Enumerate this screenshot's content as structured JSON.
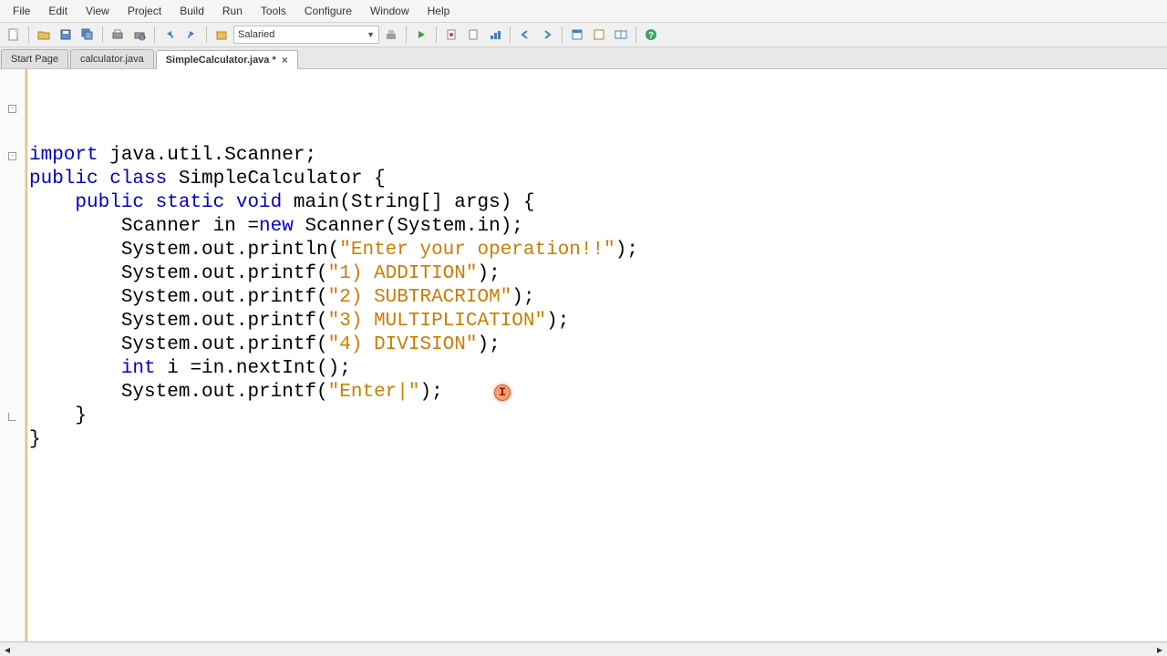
{
  "menu": {
    "items": [
      "File",
      "Edit",
      "View",
      "Project",
      "Build",
      "Run",
      "Tools",
      "Configure",
      "Window",
      "Help"
    ]
  },
  "toolbar": {
    "dropdown_value": "Salaried"
  },
  "tabs": [
    {
      "label": "Start Page",
      "active": false,
      "closable": false
    },
    {
      "label": "calculator.java",
      "active": false,
      "closable": false
    },
    {
      "label": "SimpleCalculator.java *",
      "active": true,
      "closable": true
    }
  ],
  "code": {
    "lines": [
      {
        "tokens": [
          {
            "t": "import ",
            "c": "kw"
          },
          {
            "t": "java.util.Scanner;",
            "c": "norm"
          }
        ]
      },
      {
        "tokens": [
          {
            "t": "public class ",
            "c": "kw"
          },
          {
            "t": "SimpleCalculator {",
            "c": "norm"
          }
        ],
        "fold": true
      },
      {
        "tokens": [
          {
            "t": "",
            "c": "norm"
          }
        ]
      },
      {
        "tokens": [
          {
            "t": "    ",
            "c": "norm"
          },
          {
            "t": "public static void ",
            "c": "kw"
          },
          {
            "t": "main(String[] args) {",
            "c": "norm"
          }
        ],
        "fold": true
      },
      {
        "tokens": [
          {
            "t": "        Scanner in =",
            "c": "norm"
          },
          {
            "t": "new ",
            "c": "kw"
          },
          {
            "t": "Scanner(System.in);",
            "c": "norm"
          }
        ]
      },
      {
        "tokens": [
          {
            "t": "        System.out.println(",
            "c": "norm"
          },
          {
            "t": "\"Enter your operation!!\"",
            "c": "str"
          },
          {
            "t": ");",
            "c": "norm"
          }
        ]
      },
      {
        "tokens": [
          {
            "t": "        System.out.printf(",
            "c": "norm"
          },
          {
            "t": "\"1) ADDITION\"",
            "c": "str"
          },
          {
            "t": ");",
            "c": "norm"
          }
        ]
      },
      {
        "tokens": [
          {
            "t": "        System.out.printf(",
            "c": "norm"
          },
          {
            "t": "\"2) SUBTRACRIOM\"",
            "c": "str"
          },
          {
            "t": ");",
            "c": "norm"
          }
        ]
      },
      {
        "tokens": [
          {
            "t": "        System.out.printf(",
            "c": "norm"
          },
          {
            "t": "\"3) MULTIPLICATION\"",
            "c": "str"
          },
          {
            "t": ");",
            "c": "norm"
          }
        ]
      },
      {
        "tokens": [
          {
            "t": "        System.out.printf(",
            "c": "norm"
          },
          {
            "t": "\"4) DIVISION\"",
            "c": "str"
          },
          {
            "t": ");",
            "c": "norm"
          }
        ]
      },
      {
        "tokens": [
          {
            "t": "        ",
            "c": "norm"
          },
          {
            "t": "int ",
            "c": "kw"
          },
          {
            "t": "i =in.nextInt();",
            "c": "norm"
          }
        ]
      },
      {
        "tokens": [
          {
            "t": "",
            "c": "norm"
          }
        ]
      },
      {
        "tokens": [
          {
            "t": "        System.out.printf(",
            "c": "norm"
          },
          {
            "t": "\"Enter|\"",
            "c": "str"
          },
          {
            "t": ");",
            "c": "norm"
          }
        ],
        "error_after": true
      },
      {
        "tokens": [
          {
            "t": "    }",
            "c": "norm"
          }
        ]
      },
      {
        "tokens": [
          {
            "t": "}",
            "c": "norm"
          }
        ],
        "fold_end": true
      }
    ]
  },
  "error_marker": {
    "glyph": "I"
  }
}
